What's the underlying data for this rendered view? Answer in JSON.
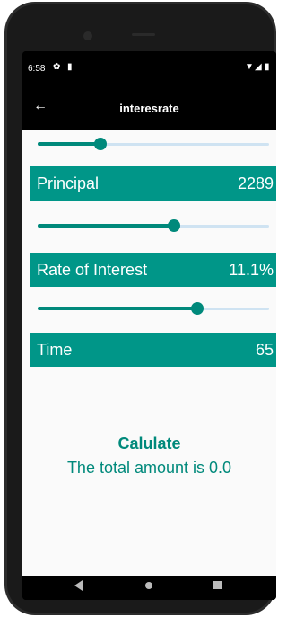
{
  "status_bar": {
    "time": "6:58",
    "left_icons": [
      "gear-icon",
      "sd-card-icon"
    ],
    "right_icons": [
      "wifi-icon",
      "signal-icon",
      "battery-icon"
    ]
  },
  "app_bar": {
    "title": "interesrate",
    "back_icon": "arrow-left-icon"
  },
  "sliders": {
    "principal": {
      "value_fraction": 0.27
    },
    "rate": {
      "value_fraction": 0.59
    },
    "time": {
      "value_fraction": 0.69
    }
  },
  "fields": {
    "principal": {
      "label": "Principal",
      "value": "2289"
    },
    "rate": {
      "label": "Rate of Interest",
      "value": "11.1%"
    },
    "time": {
      "label": "Time",
      "value": "65"
    }
  },
  "actions": {
    "calculate_label": "Calulate"
  },
  "result": {
    "text": "The total amount is 0.0"
  },
  "colors": {
    "accent": "#009688",
    "slider_active": "#00897b",
    "slider_track": "#cfe3f2",
    "background": "#fafafa"
  }
}
